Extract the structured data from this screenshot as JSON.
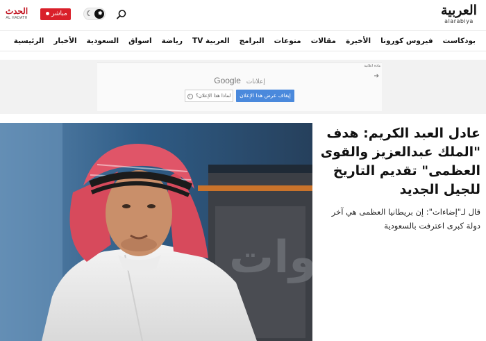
{
  "header": {
    "logo_main": "العربية",
    "logo_sub": "alarabiya",
    "search_icon": "search-icon",
    "theme_moon": "☾",
    "theme_sun": "✹",
    "live_label": "مباشر",
    "hadath_main": "الحدث",
    "hadath_sub": "AL HADATH"
  },
  "nav": {
    "items": [
      "الرئيسية",
      "الأخبار",
      "السعودية",
      "اسواق",
      "رياضة",
      "العربية TV",
      "البرامج",
      "منوعات",
      "مقالات",
      "الأخيرة",
      "فيروس كورونا",
      "بودكاست"
    ]
  },
  "ad": {
    "marker": "مادة اعلانية",
    "google": "Google",
    "ads_label": "إعلانات",
    "stop_label": "إيقاف عرض هذا الإعلان",
    "why_label": "لماذا هذا الإعلان؟",
    "info_glyph": "i"
  },
  "hero": {
    "title": "عادل العبد الكريم: هدف \"الملك عبدالعزيز والقوى العظمى\" تقديم التاريخ للجيل الجديد",
    "summary": "قال لـ\"إضاءات\": إن بريطانيا العظمى هي آخر دولة كبرى اعترفت بالسعودية"
  }
}
